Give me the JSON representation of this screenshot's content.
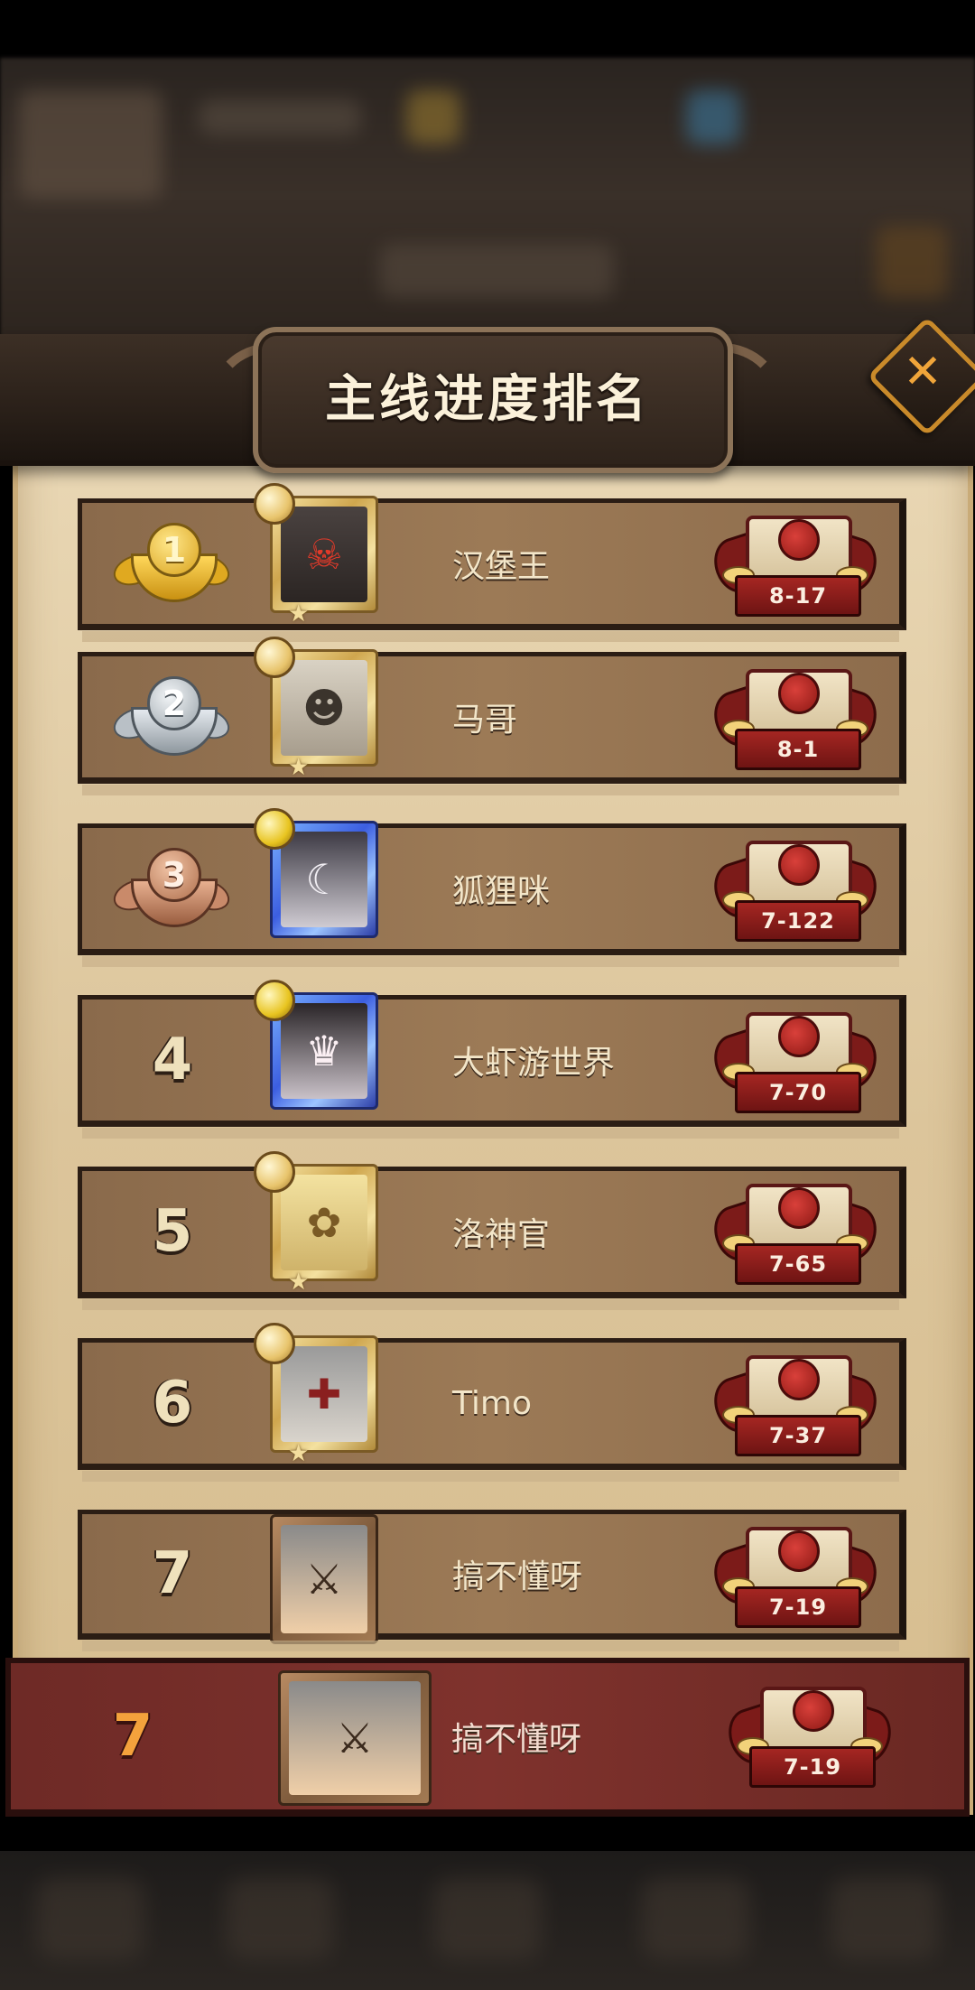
{
  "title": "主线进度排名",
  "colors": {
    "row_bg": "#9c7a56",
    "highlight_row_bg": "#7f322d",
    "rank_text": "#efe1bc",
    "highlight_rank_text": "#f4a23c",
    "stage_ribbon": "#a52622"
  },
  "close_icon": "close-icon",
  "rankings": [
    {
      "rank": "1",
      "name": "汉堡王",
      "stage": "8-17",
      "medal": "gold",
      "frame": "gold",
      "avatar_icon": "masked-helmet-hero"
    },
    {
      "rank": "2",
      "name": "马哥",
      "stage": "8-1",
      "medal": "silver",
      "frame": "gold",
      "avatar_icon": "bandaged-mummy-hero"
    },
    {
      "rank": "3",
      "name": "狐狸咪",
      "stage": "7-122",
      "medal": "bronze",
      "frame": "blue",
      "avatar_icon": "white-haired-witch-hero"
    },
    {
      "rank": "4",
      "name": "大虾游世界",
      "stage": "7-70",
      "medal": "",
      "frame": "blue",
      "avatar_icon": "hooded-princess-hero"
    },
    {
      "rank": "5",
      "name": "洛神官",
      "stage": "7-65",
      "medal": "",
      "frame": "gold",
      "avatar_icon": "blonde-priestess-hero"
    },
    {
      "rank": "6",
      "name": "Timo",
      "stage": "7-37",
      "medal": "",
      "frame": "gold",
      "avatar_icon": "knight-helmet-hero"
    },
    {
      "rank": "7",
      "name": "搞不懂呀",
      "stage": "7-19",
      "medal": "",
      "frame": "bronze",
      "avatar_icon": "armored-girl-hero"
    }
  ],
  "my_rank": {
    "rank": "7",
    "name": "搞不懂呀",
    "stage": "7-19",
    "frame": "bronze",
    "avatar_icon": "armored-girl-hero"
  }
}
